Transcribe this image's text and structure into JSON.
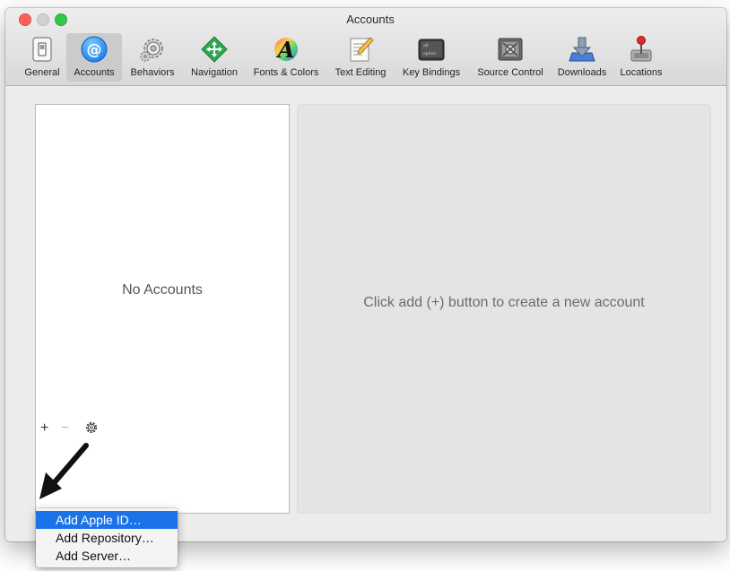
{
  "window": {
    "title": "Accounts"
  },
  "toolbar": {
    "items": [
      {
        "label": "General",
        "icon": "general-switch-icon"
      },
      {
        "label": "Accounts",
        "icon": "at-sign-icon",
        "selected": true
      },
      {
        "label": "Behaviors",
        "icon": "gears-icon"
      },
      {
        "label": "Navigation",
        "icon": "navigation-arrows-icon"
      },
      {
        "label": "Fonts & Colors",
        "icon": "fonts-colors-icon"
      },
      {
        "label": "Text Editing",
        "icon": "text-editing-icon"
      },
      {
        "label": "Key Bindings",
        "icon": "keyboard-key-icon"
      },
      {
        "label": "Source Control",
        "icon": "source-control-icon"
      },
      {
        "label": "Downloads",
        "icon": "downloads-icon"
      },
      {
        "label": "Locations",
        "icon": "locations-joystick-icon"
      }
    ]
  },
  "accounts_list": {
    "empty_text": "No Accounts"
  },
  "detail": {
    "hint": "Click add (+) button to create a new account"
  },
  "list_controls": {
    "add": "+",
    "remove": "−",
    "gear_icon": "gear-icon"
  },
  "add_menu": {
    "items": [
      {
        "label": "Add Apple ID…",
        "highlighted": true
      },
      {
        "label": "Add Repository…"
      },
      {
        "label": "Add Server…"
      }
    ]
  },
  "colors": {
    "close": "#fc605c",
    "minimize": "#d1d1d1",
    "zoom": "#34c84a",
    "accent": "#1a73e8",
    "menu_highlight": "#1a73e8"
  }
}
